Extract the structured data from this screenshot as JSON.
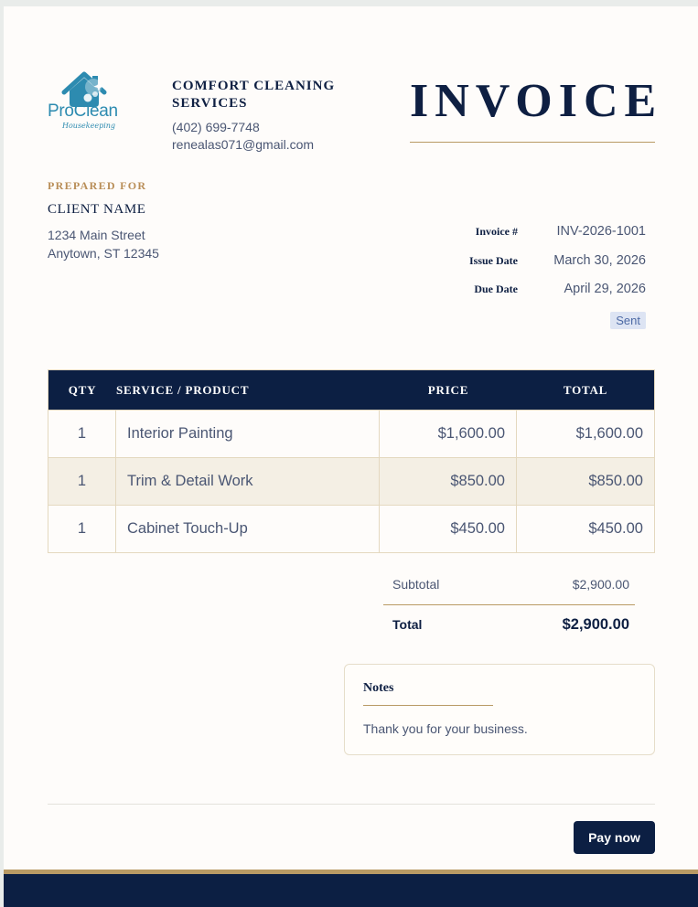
{
  "brand": {
    "logo_name": "ProClean",
    "logo_tagline": "Housekeeping",
    "accent_blue": "#2d8bb0",
    "navy": "#0c1f43",
    "gold": "#b99a64"
  },
  "company": {
    "name": "COMFORT CLEANING SERVICES",
    "phone": "(402) 699-7748",
    "email": "renealas071@gmail.com"
  },
  "document_title": "INVOICE",
  "prepared_for": {
    "label": "PREPARED FOR",
    "client_name": "CLIENT NAME",
    "address_line1": "1234 Main Street",
    "address_line2": "Anytown, ST 12345"
  },
  "meta": [
    {
      "label": "Invoice #",
      "value": "INV-2026-1001"
    },
    {
      "label": "Issue Date",
      "value": "March 30, 2026"
    },
    {
      "label": "Due Date",
      "value": "April 29, 2026"
    }
  ],
  "status_badge": "Sent",
  "table": {
    "headers": {
      "qty": "QTY",
      "service": "SERVICE / PRODUCT",
      "price": "PRICE",
      "total": "TOTAL"
    },
    "rows": [
      {
        "qty": "1",
        "service": "Interior Painting",
        "price": "$1,600.00",
        "total": "$1,600.00"
      },
      {
        "qty": "1",
        "service": "Trim & Detail Work",
        "price": "$850.00",
        "total": "$850.00"
      },
      {
        "qty": "1",
        "service": "Cabinet Touch-Up",
        "price": "$450.00",
        "total": "$450.00"
      }
    ]
  },
  "totals": {
    "subtotal_label": "Subtotal",
    "subtotal_value": "$2,900.00",
    "total_label": "Total",
    "total_value": "$2,900.00"
  },
  "notes": {
    "title": "Notes",
    "text": "Thank you for your business."
  },
  "pay_button": "Pay now"
}
